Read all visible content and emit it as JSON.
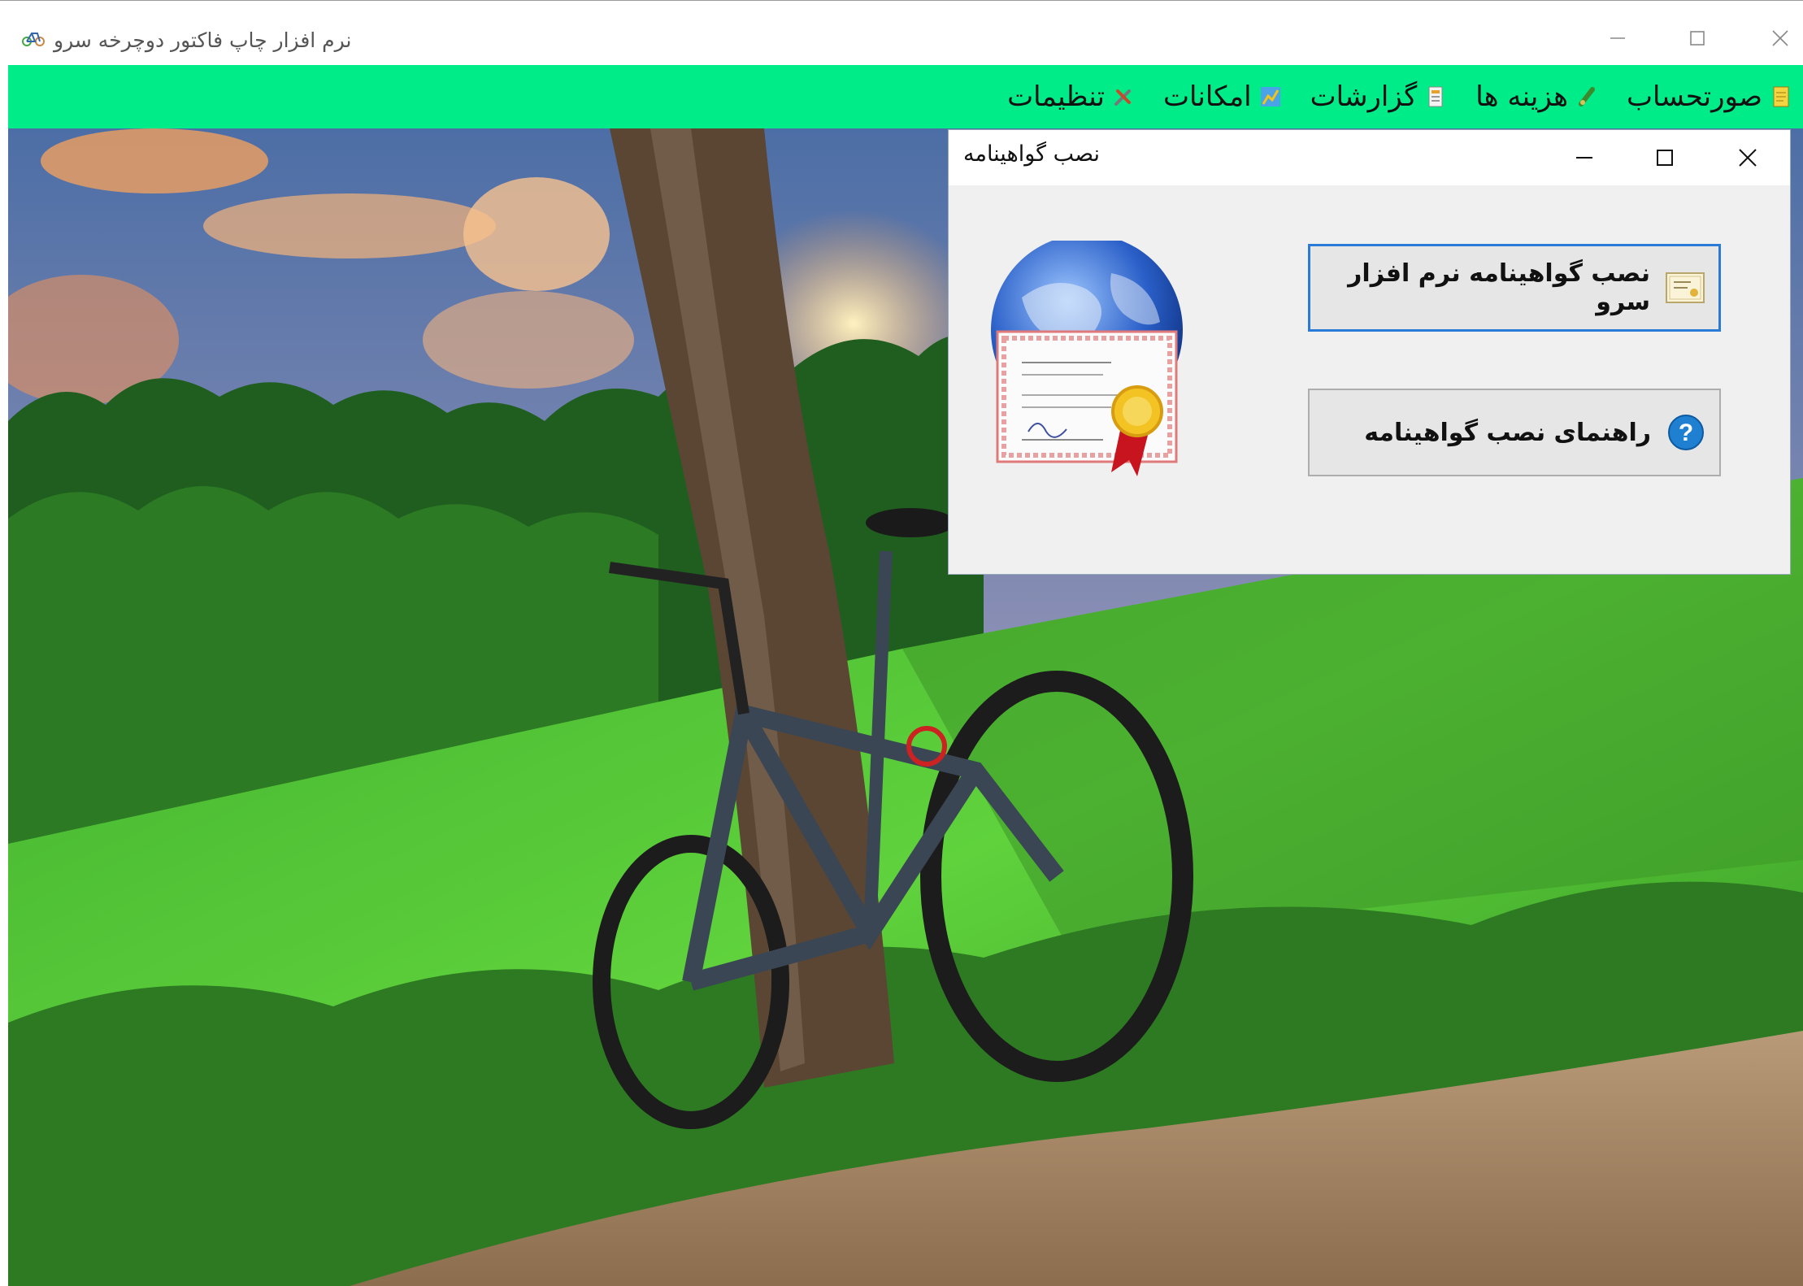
{
  "window": {
    "title": "نرم افزار چاپ فاکتور دوچرخه سرو"
  },
  "menu": {
    "items": [
      {
        "label": "صورتحساب",
        "icon": "invoice-icon"
      },
      {
        "label": "هزینه ها",
        "icon": "expenses-icon"
      },
      {
        "label": "گزارشات",
        "icon": "reports-icon"
      },
      {
        "label": "امکانات",
        "icon": "tools-icon"
      },
      {
        "label": "تنظیمات",
        "icon": "settings-icon"
      }
    ]
  },
  "dialog": {
    "title": "نصب گواهینامه",
    "install_button": "نصب گواهینامه نرم افزار سرو",
    "help_button": "راهنمای نصب گواهینامه"
  },
  "colors": {
    "menubar": "#00ec89",
    "primary_border": "#2a7ad7",
    "help_icon": "#1f7fd0"
  }
}
